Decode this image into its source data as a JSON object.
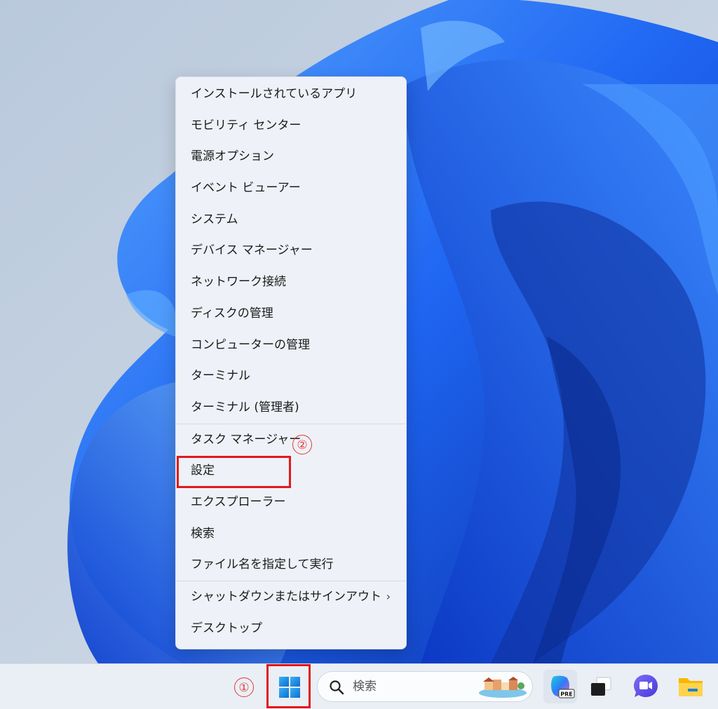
{
  "context_menu": {
    "items": [
      {
        "label": "インストールされているアプリ"
      },
      {
        "label": "モビリティ センター"
      },
      {
        "label": "電源オプション"
      },
      {
        "label": "イベント ビューアー"
      },
      {
        "label": "システム"
      },
      {
        "label": "デバイス マネージャー"
      },
      {
        "label": "ネットワーク接続"
      },
      {
        "label": "ディスクの管理"
      },
      {
        "label": "コンピューターの管理"
      },
      {
        "label": "ターミナル"
      },
      {
        "label": "ターミナル (管理者)"
      },
      {
        "label": "タスク マネージャー"
      },
      {
        "label": "設定"
      },
      {
        "label": "エクスプローラー"
      },
      {
        "label": "検索"
      },
      {
        "label": "ファイル名を指定して実行"
      },
      {
        "label": "シャットダウンまたはサインアウト"
      },
      {
        "label": "デスクトップ"
      }
    ],
    "submenu_chevron": "›"
  },
  "annotations": {
    "step1": "①",
    "step2": "②",
    "highlight_color": "#e0191b"
  },
  "taskbar": {
    "search_placeholder": "検索",
    "copilot_badge": "PRE",
    "icons": [
      "windows-start-icon",
      "search-icon",
      "copilot-icon",
      "task-view-icon",
      "meet-icon",
      "file-explorer-icon"
    ]
  },
  "colors": {
    "wallpaper_bg": "#c7d3e2",
    "bloom_blue": "#1a5df0",
    "accent": "#0078d4"
  }
}
